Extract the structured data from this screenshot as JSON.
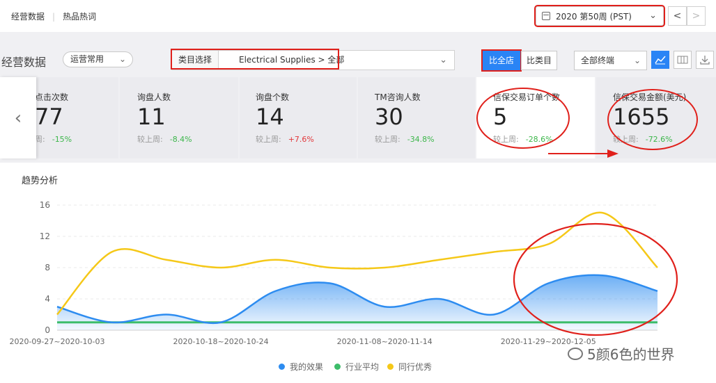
{
  "header": {
    "tabs": [
      "经营数据",
      "热品热词"
    ],
    "date": "2020 第50周 (PST)",
    "prev_icon": "chevron-left-icon",
    "next_icon": "chevron-right-icon"
  },
  "toolbar": {
    "title": "经营数据",
    "preset": "运营常用",
    "category_label": "类目选择",
    "category_value": "Electrical Supplies > 全部",
    "compare_store": "比全店",
    "compare_category": "比类目",
    "terminal": "全部终端",
    "icons": [
      "line-chart-icon",
      "columns-icon",
      "download-icon"
    ]
  },
  "metrics": [
    {
      "label": "点击次数",
      "value": "77",
      "compare_label": "周:",
      "change": "-15%",
      "dir": "down"
    },
    {
      "label": "询盘人数",
      "value": "11",
      "compare_label": "较上周:",
      "change": "-8.4%",
      "dir": "down"
    },
    {
      "label": "询盘个数",
      "value": "14",
      "compare_label": "较上周:",
      "change": "+7.6%",
      "dir": "up"
    },
    {
      "label": "TM咨询人数",
      "value": "30",
      "compare_label": "较上周:",
      "change": "-34.8%",
      "dir": "down"
    },
    {
      "label": "信保交易订单个数",
      "value": "5",
      "compare_label": "较上周:",
      "change": "-28.6%",
      "dir": "down"
    },
    {
      "label": "信保交易金额(美元)",
      "value": "1655",
      "compare_label": "较上周:",
      "change": "-72.6%",
      "dir": "down"
    }
  ],
  "chart_title": "趋势分析",
  "chart_data": {
    "type": "area",
    "x": [
      "2020-09-27~2020-10-03",
      "",
      "",
      "2020-10-18~2020-10-24",
      "",
      "",
      "2020-11-08~2020-11-14",
      "",
      "",
      "2020-11-29~2020-12-05",
      "",
      ""
    ],
    "tick_labels": [
      "2020-09-27~2020-10-03",
      "2020-10-18~2020-10-24",
      "2020-11-08~2020-11-14",
      "2020-11-29~2020-12-05"
    ],
    "y_ticks": [
      0,
      4,
      8,
      12,
      16
    ],
    "ylim": [
      0,
      16
    ],
    "series": [
      {
        "name": "我的效果",
        "color": "#2d8cf0",
        "values": [
          3,
          1,
          2,
          1,
          5,
          6,
          3,
          4,
          2,
          6,
          7,
          5
        ]
      },
      {
        "name": "行业平均",
        "color": "#3dbd6a",
        "values": [
          1,
          1,
          1,
          1,
          1,
          1,
          1,
          1,
          1,
          1,
          1,
          1
        ]
      },
      {
        "name": "同行优秀",
        "color": "#f5c818",
        "values": [
          2,
          10,
          9,
          8,
          9,
          8,
          8,
          9,
          10,
          11,
          15,
          8
        ]
      }
    ],
    "legend_position": "bottom",
    "grid": true
  },
  "watermark": "5颜6色的世界"
}
